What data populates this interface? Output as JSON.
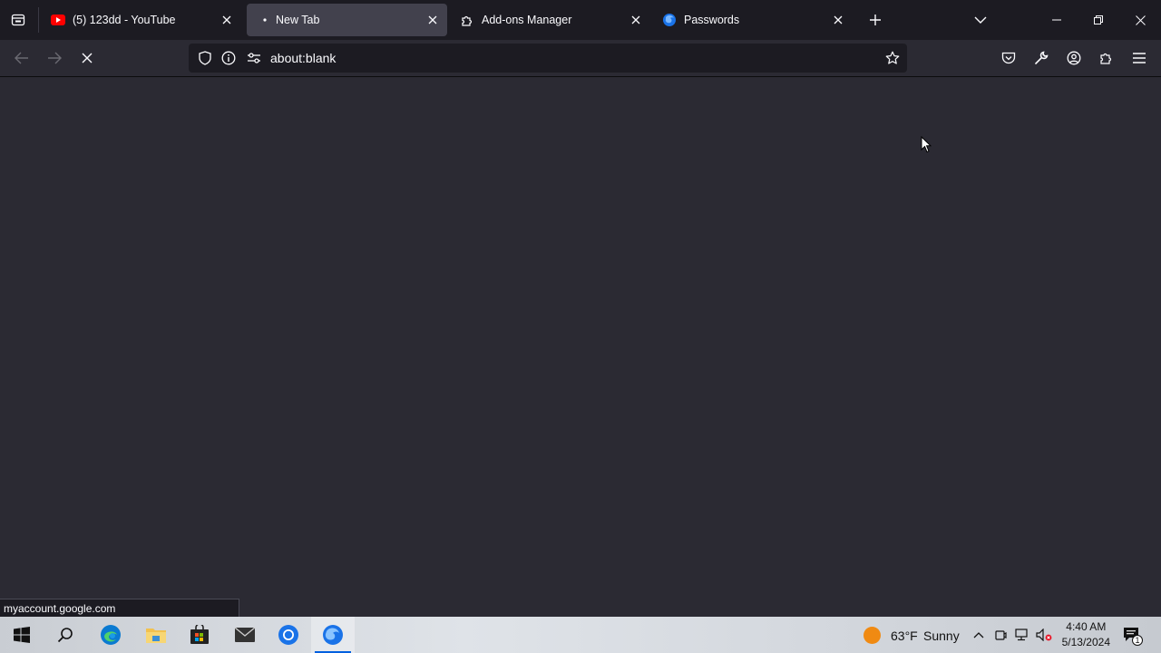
{
  "tabs": [
    {
      "label": "(5) 123dd - YouTube",
      "icon": "youtube-icon",
      "active": false
    },
    {
      "label": "New Tab",
      "icon": "loading-dot-icon",
      "active": true
    },
    {
      "label": "Add-ons Manager",
      "icon": "puzzle-icon",
      "active": false
    },
    {
      "label": "Passwords",
      "icon": "firefox-icon",
      "active": false
    }
  ],
  "navbar": {
    "url": "about:blank"
  },
  "status": {
    "link": "myaccount.google.com"
  },
  "taskbar": {
    "weather_temp": "63°F",
    "weather_desc": "Sunny",
    "time": "4:40 AM",
    "date": "5/13/2024",
    "notification_count": "1"
  },
  "colors": {
    "accent": "#0060df",
    "chrome_dark": "#1c1b22",
    "content": "#2b2a33"
  }
}
